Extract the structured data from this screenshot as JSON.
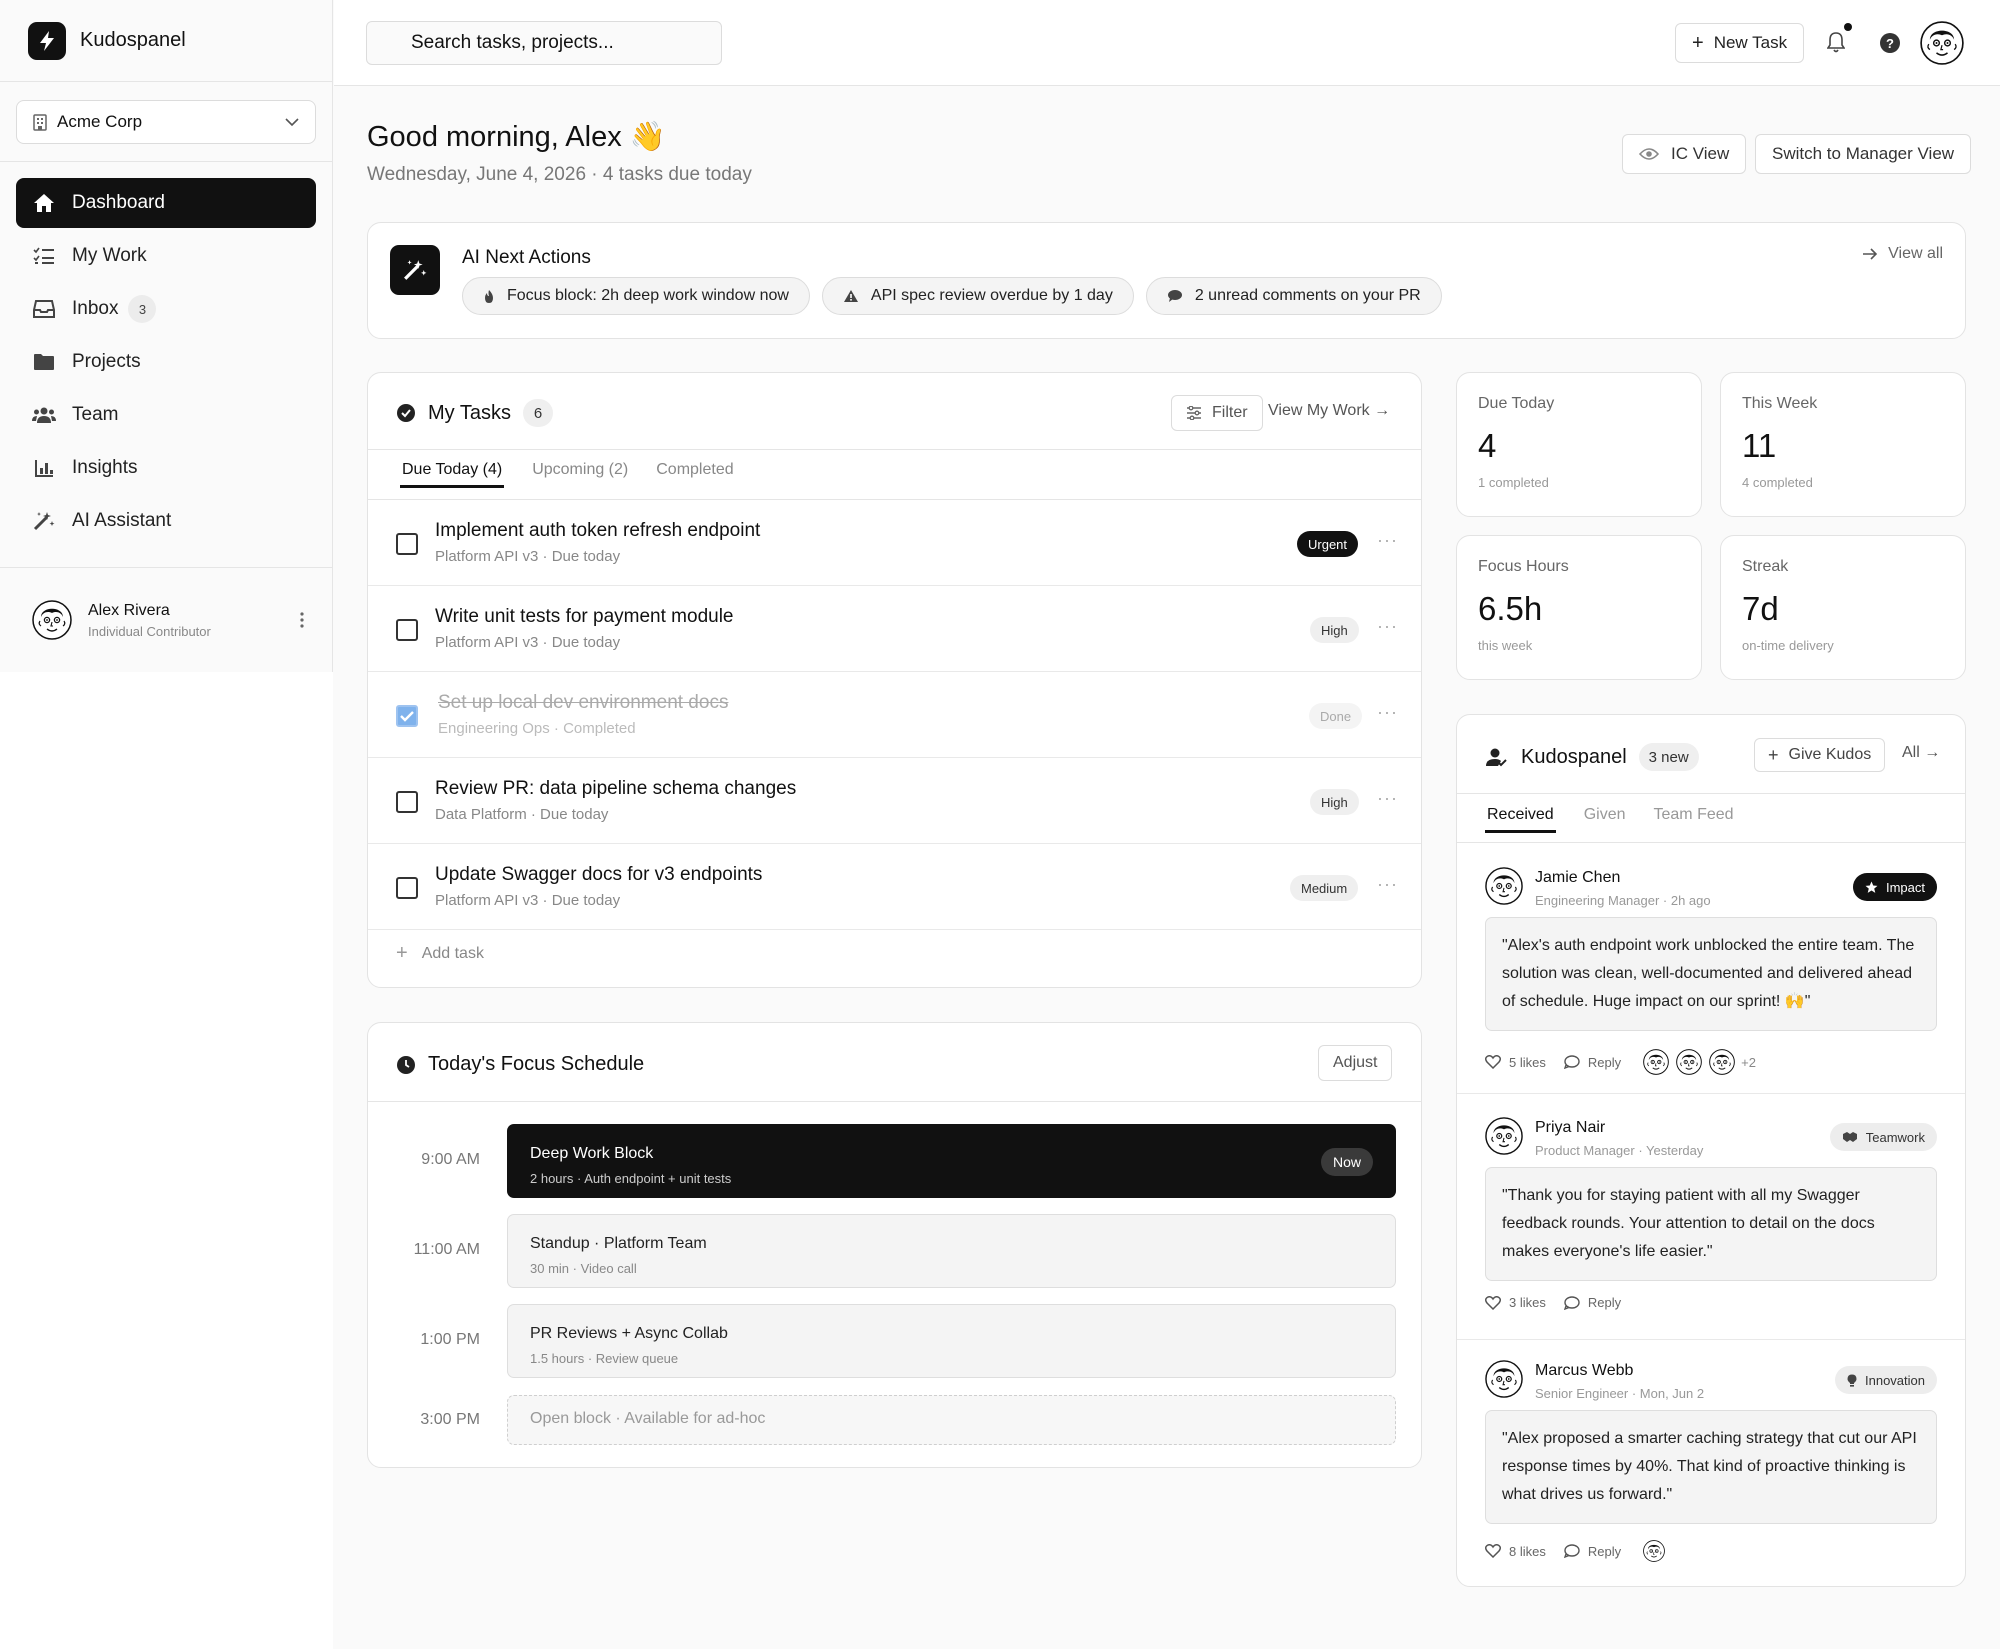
{
  "app": {
    "name": "Kudospanel",
    "workspace": "Acme Corp"
  },
  "nav": [
    {
      "label": "Dashboard",
      "icon": "home-icon",
      "active": true
    },
    {
      "label": "My Work",
      "icon": "list-checks-icon"
    },
    {
      "label": "Inbox",
      "icon": "inbox-icon",
      "badge": "3"
    },
    {
      "label": "Projects",
      "icon": "folder-icon"
    },
    {
      "label": "Team",
      "icon": "users-icon"
    },
    {
      "label": "Insights",
      "icon": "bar-chart-icon"
    },
    {
      "label": "AI Assistant",
      "icon": "magic-wand-icon"
    }
  ],
  "user": {
    "name": "Alex Rivera",
    "role": "Individual Contributor"
  },
  "topbar": {
    "search_placeholder": "Search tasks, projects...",
    "new_task": "New Task"
  },
  "header": {
    "greeting": "Good morning, Alex 👋",
    "subtitle": "Wednesday, June 4, 2026 · 4 tasks due today",
    "ic_view": "IC View",
    "manager_view": "Switch to Manager View"
  },
  "ai": {
    "title": "AI Next Actions",
    "view_all": "View all",
    "chips": [
      {
        "label": "Focus block: 2h deep work window now",
        "icon": "fire-icon"
      },
      {
        "label": "API spec review overdue by 1 day",
        "icon": "warning-icon"
      },
      {
        "label": "2 unread comments on your PR",
        "icon": "comment-icon"
      }
    ]
  },
  "tasks": {
    "title": "My Tasks",
    "count": "6",
    "filter": "Filter",
    "view_my_work": "View My Work →",
    "tabs": [
      "Due Today (4)",
      "Upcoming (2)",
      "Completed"
    ],
    "rows": [
      {
        "title": "Implement auth token refresh endpoint",
        "meta": "Platform API v3 · Due today",
        "priority": "Urgent",
        "done": false
      },
      {
        "title": "Write unit tests for payment module",
        "meta": "Platform API v3 · Due today",
        "priority": "High",
        "done": false
      },
      {
        "title": "Set up local dev environment docs",
        "meta": "Engineering Ops · Completed",
        "priority": "Done",
        "done": true
      },
      {
        "title": "Review PR: data pipeline schema changes",
        "meta": "Data Platform · Due today",
        "priority": "High",
        "done": false
      },
      {
        "title": "Update Swagger docs for v3 endpoints",
        "meta": "Platform API v3 · Due today",
        "priority": "Medium",
        "done": false
      }
    ],
    "more": "···",
    "add_task": "Add task"
  },
  "focus": {
    "title": "Today's Focus Schedule",
    "adjust": "Adjust",
    "slots": [
      {
        "time": "9:00 AM",
        "title": "Deep Work Block",
        "sub": "2 hours · Auth endpoint + unit tests",
        "badge": "Now"
      },
      {
        "time": "11:00 AM",
        "title": "Standup · Platform Team",
        "sub": "30 min · Video call"
      },
      {
        "time": "1:00 PM",
        "title": "PR Reviews + Async Collab",
        "sub": "1.5 hours · Review queue"
      },
      {
        "time": "3:00 PM",
        "title": "Open block · Available for ad-hoc"
      }
    ]
  },
  "stats": [
    {
      "label": "Due Today",
      "value": "4",
      "sub": "1 completed"
    },
    {
      "label": "This Week",
      "value": "11",
      "sub": "4 completed"
    },
    {
      "label": "Focus Hours",
      "value": "6.5h",
      "sub": "this week"
    },
    {
      "label": "Streak",
      "value": "7d",
      "sub": "on-time delivery"
    }
  ],
  "kudos": {
    "title": "Kudospanel",
    "new_count": "3 new",
    "give": "Give Kudos",
    "all": "All →",
    "tabs": [
      "Received",
      "Given",
      "Team Feed"
    ],
    "reply": "Reply",
    "items": [
      {
        "name": "Jamie Chen",
        "meta": "Engineering Manager · 2h ago",
        "tag": "Impact",
        "tag_icon": "star-icon",
        "quote": "\"Alex's auth endpoint work unblocked the entire team. The solution was clean, well-documented and delivered ahead of schedule. Huge impact on our sprint! 🙌\"",
        "likes": "5 likes",
        "more": "+2"
      },
      {
        "name": "Priya Nair",
        "meta": "Product Manager · Yesterday",
        "tag": "Teamwork",
        "tag_icon": "handshake-icon",
        "quote": "\"Thank you for staying patient with all my Swagger feedback rounds. Your attention to detail on the docs makes everyone's life easier.\"",
        "likes": "3 likes"
      },
      {
        "name": "Marcus Webb",
        "meta": "Senior Engineer · Mon, Jun 2",
        "tag": "Innovation",
        "tag_icon": "lightbulb-icon",
        "quote": "\"Alex proposed a smarter caching strategy that cut our API response times by 40%. That kind of proactive thinking is what drives us forward.\"",
        "likes": "8 likes"
      }
    ]
  }
}
